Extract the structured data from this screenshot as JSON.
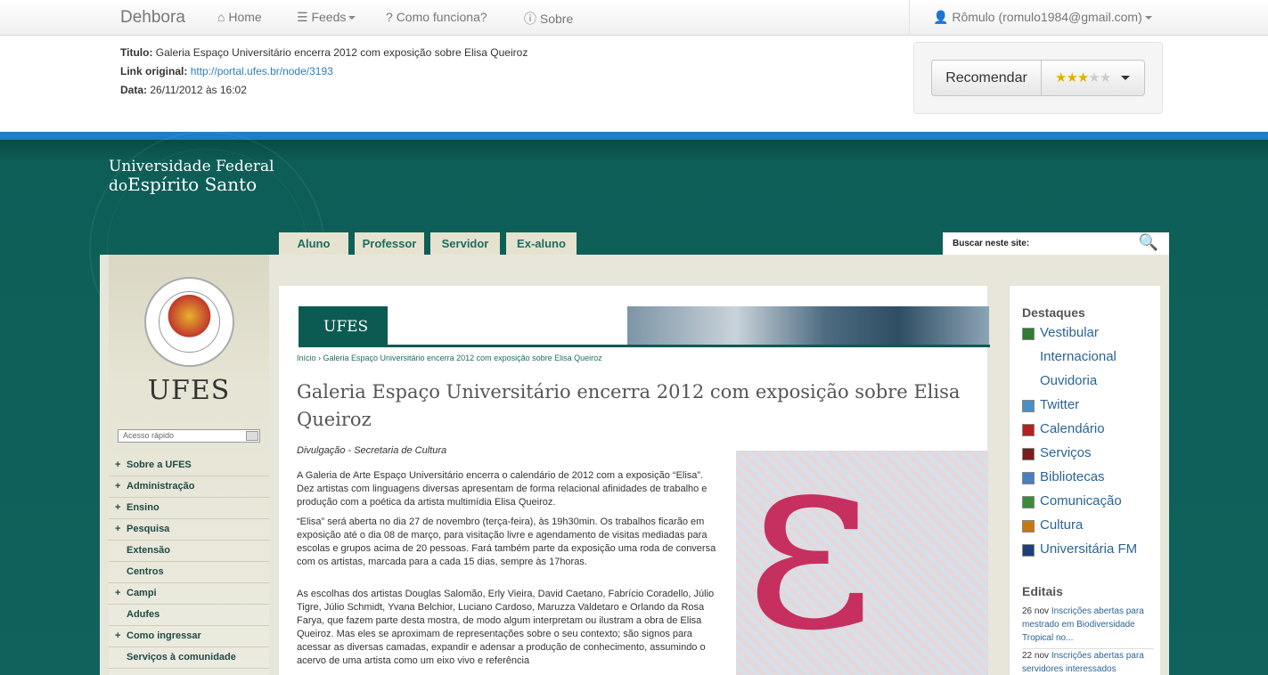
{
  "navbar": {
    "brand": "Dehbora",
    "home": "Home",
    "feeds": "Feeds",
    "how": "Como funciona?",
    "about": "Sobre",
    "user": "Rômulo (romulo1984@gmail.com)"
  },
  "item": {
    "title_label": "Titulo:",
    "title": "Galeria Espaço Universitário encerra 2012 com exposição sobre Elisa Queiroz",
    "link_label": "Link original:",
    "link": "http://portal.ufes.br/node/3193",
    "date_label": "Data:",
    "date": "26/11/2012 às 16:02"
  },
  "recommend": {
    "label": "Recomendar",
    "rating": 3,
    "max": 5
  },
  "site": {
    "name_line1": "Universidade Federal",
    "name_line2a": "do",
    "name_line2b": "Espírito Santo",
    "tabs": [
      "Aluno",
      "Professor",
      "Servidor",
      "Ex-aluno"
    ],
    "search_label": "Buscar neste site:",
    "logo": "UFES",
    "quick_access": "Acesso rápido",
    "menu": [
      {
        "label": "Sobre a UFES",
        "plus": true
      },
      {
        "label": "Administração",
        "plus": true
      },
      {
        "label": "Ensino",
        "plus": true
      },
      {
        "label": "Pesquisa",
        "plus": true
      },
      {
        "label": "Extensão",
        "plus": false
      },
      {
        "label": "Centros",
        "plus": false
      },
      {
        "label": "Campi",
        "plus": true
      },
      {
        "label": "Adufes",
        "plus": false
      },
      {
        "label": "Como ingressar",
        "plus": true
      },
      {
        "label": "Serviços à comunidade",
        "plus": false
      }
    ]
  },
  "article": {
    "banner": "UFES",
    "breadcrumb": "Início › Galeria Espaço Universitário encerra 2012 com exposição sobre Elisa Queiroz",
    "title": "Galeria Espaço Universitário encerra 2012 com exposição sobre Elisa Queiroz",
    "credit": "Divulgação - Secretaria de Cultura",
    "p1": "A Galeria de Arte Espaço Universitário encerra o calendário de 2012 com a exposição “Elisa”. Dez artistas com linguagens diversas apresentam de forma relacional afinidades de trabalho e produção com a poética da artista multimídia Elisa Queiroz.",
    "p2": "“Elisa” será aberta no dia 27 de novembro (terça-feira), às 19h30min. Os trabalhos ficarão em exposição até o dia 08 de março, para visitação livre e agendamento de visitas mediadas para escolas e grupos acima de 20 pessoas. Fará também parte da exposição uma roda de conversa com os artistas, marcada para a cada 15 dias, sempre às 17horas.",
    "p3": "As escolhas dos artistas Douglas Salomão, Erly Vieira, David Caetano, Fabrício Coradello, Júlio Tigre, Júlio Schmidt, Yvana Belchior, Luciano Cardoso, Maruzza Valdetaro e Orlando da Rosa Farya, que fazem parte desta mostra, de modo algum interpretam ou ilustram a obra de Elisa Queiroz. Mas eles se aproximam de representações sobre o seu contexto; são signos para acessar as diversas camadas, expandir e adensar a produção de conhecimento, assumindo o acervo de uma artista como um eixo vivo e referência"
  },
  "sidebar": {
    "highlights_title": "Destaques",
    "highlights": [
      {
        "label": "Vestibular",
        "icon": "vestibular-icon",
        "color": "#2e7d32"
      },
      {
        "label": "Internacional",
        "icon": "",
        "color": ""
      },
      {
        "label": "Ouvidoria",
        "icon": "",
        "color": ""
      },
      {
        "label": "Twitter",
        "icon": "twitter-icon",
        "color": "#4a90c2"
      },
      {
        "label": "Calendário",
        "icon": "calendar-icon",
        "color": "#b22222"
      },
      {
        "label": "Serviços",
        "icon": "services-icon",
        "color": "#7a1d1d"
      },
      {
        "label": "Bibliotecas",
        "icon": "library-icon",
        "color": "#4a7fc1"
      },
      {
        "label": "Comunicação",
        "icon": "communication-icon",
        "color": "#3a8c3a"
      },
      {
        "label": "Cultura",
        "icon": "culture-icon",
        "color": "#c47a12"
      },
      {
        "label": "Universitária FM",
        "icon": "radio-icon",
        "color": "#1f3f7a"
      }
    ],
    "notices_title": "Editais",
    "notices": [
      {
        "date": "26 nov",
        "text": "Inscrições abertas para mestrado em Biodiversidade Tropical no..."
      },
      {
        "date": "22 nov",
        "text": "Inscrições abertas para servidores interessados"
      }
    ]
  }
}
